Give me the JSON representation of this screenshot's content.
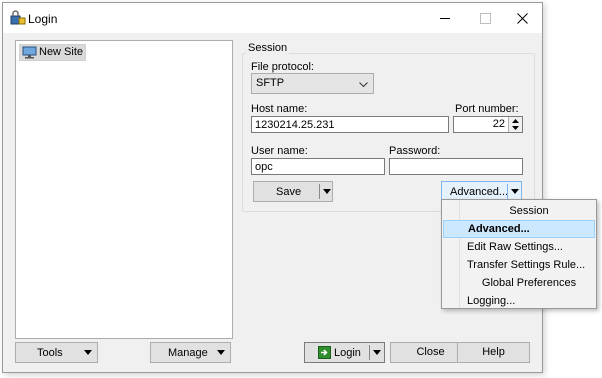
{
  "window": {
    "title": "Login"
  },
  "tree": {
    "items": [
      {
        "label": "New Site"
      }
    ]
  },
  "session": {
    "group_label": "Session",
    "file_protocol_label": "File protocol:",
    "file_protocol_value": "SFTP",
    "host_name_label": "Host name:",
    "host_name_value": "1230214.25.231",
    "port_label": "Port number:",
    "port_value": "22",
    "user_name_label": "User name:",
    "user_name_value": "opc",
    "password_label": "Password:",
    "password_value": "",
    "save_label": "Save",
    "advanced_label": "Advanced..."
  },
  "menu": {
    "items": [
      {
        "label": "Session",
        "type": "header"
      },
      {
        "label": "Advanced...",
        "type": "item",
        "highlighted": true
      },
      {
        "label": "Edit Raw Settings...",
        "type": "item"
      },
      {
        "label": "Transfer Settings Rule...",
        "type": "item"
      },
      {
        "label": "Global Preferences",
        "type": "header"
      },
      {
        "label": "Logging...",
        "type": "item"
      }
    ]
  },
  "footer": {
    "tools_label": "Tools",
    "manage_label": "Manage",
    "login_label": "Login",
    "close_label": "Close",
    "help_label": "Help"
  },
  "colors": {
    "menu_highlight": "#cce8ff",
    "menu_highlight_border": "#99d1ff",
    "window_bg": "#f0f0f0"
  },
  "icons": [
    "app-login-icon",
    "minimize-icon",
    "maximize-icon",
    "close-icon",
    "computer-icon",
    "chevron-down-icon",
    "spin-up-icon",
    "spin-down-icon",
    "login-icon"
  ]
}
